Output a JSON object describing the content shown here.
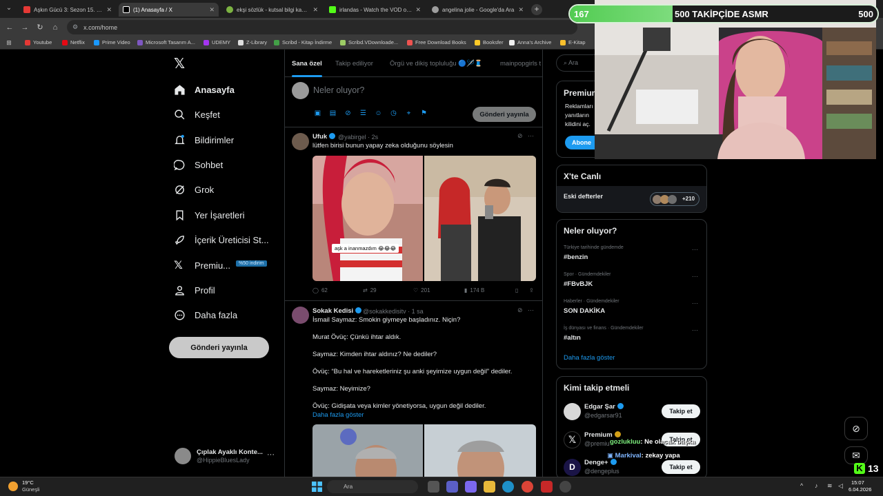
{
  "browser": {
    "tabs": [
      {
        "label": "Aşkın Gücü 3: Sezon 15. Bölüm",
        "color": "#e53935"
      },
      {
        "label": "(1) Anasayfa / X",
        "color": "#ffffff"
      },
      {
        "label": "ekşi sözlük - kutsal bilgi kaynağı",
        "color": "#7cb342"
      },
      {
        "label": "irlandas - Watch the VOD on Kick",
        "color": "#53fc18"
      },
      {
        "label": "angelina jolie - Google'da Ara",
        "color": "#9e9e9e"
      }
    ],
    "url": "x.com/home",
    "bookmarks": [
      "Youtube",
      "Netflix",
      "Prime Video",
      "Microsoft Tasarım A...",
      "UDEMY",
      "Z-Library",
      "Scribd - Kitap İndirme",
      "Scribd.VDownloade...",
      "Free Download Books",
      "Booksfer",
      "Anna's Archive",
      "E-Kitap"
    ]
  },
  "x": {
    "nav": [
      {
        "label": "Anasayfa",
        "icon": "home-icon"
      },
      {
        "label": "Keşfet",
        "icon": "search-icon"
      },
      {
        "label": "Bildirimler",
        "icon": "bell-icon"
      },
      {
        "label": "Sohbet",
        "icon": "chat-icon"
      },
      {
        "label": "Grok",
        "icon": "grok-icon"
      },
      {
        "label": "Yer İşaretleri",
        "icon": "bookmark-icon"
      },
      {
        "label": "İçerik Üreticisi St...",
        "icon": "rocket-icon"
      },
      {
        "label": "Premiu...",
        "icon": "x-logo-icon"
      },
      {
        "label": "Profil",
        "icon": "person-icon"
      },
      {
        "label": "Daha fazla",
        "icon": "more-circle-icon"
      }
    ],
    "premium_badge": "%50 indirim",
    "post_button": "Gönderi yayınla",
    "account": {
      "name": "Çıplak Ayaklı Konte...",
      "handle": "@HippieBluesLady"
    },
    "timeline_tabs": [
      "Sana özel",
      "Takip ediliyor",
      "Örgü ve dikiş topluluğu 🔵🪡🧵",
      "mainpopgirls t"
    ],
    "composer": {
      "placeholder": "Neler oluyor?",
      "button": "Gönderi yayınla"
    },
    "tweets": [
      {
        "name": "Ufuk",
        "handle": "@yabirgel",
        "time": "2s",
        "text": "lütfen birisi bunun yapay zeka olduğunu söylesin",
        "media_caption": "aşk a inanmazdım 😂😂😂",
        "replies": "62",
        "retweets": "29",
        "likes": "201",
        "views": "174 B"
      },
      {
        "name": "Sokak Kedisi",
        "handle": "@sokakkedisitv",
        "time": "1 sa",
        "lines": [
          "İsmail Saymaz: Smokin giymeye başladınız. Niçin?",
          "Murat Övüç: Çünkü ihtar aldık.",
          "Saymaz: Kimden ihtar aldınız? Ne dediler?",
          "Övüç: “Bu hal ve hareketleriniz şu anki şeyimize uygun değil” dediler.",
          "Saymaz: Neyimize?",
          "Övüç: Gidişata veya kimler yönetiyorsa, uygun değil dediler."
        ],
        "show_more": "Daha fazla göster"
      }
    ],
    "right": {
      "search_placeholder": "Ara",
      "premium": {
        "title": "Premium",
        "lines": [
          "Reklamları",
          "yanıtların",
          "kilidini aç."
        ],
        "button": "Abone"
      },
      "live": {
        "title": "X'te Canlı",
        "space": "Eski defterler",
        "count": "+210"
      },
      "trends_title": "Neler oluyor?",
      "trends": [
        {
          "category": "Türkiye tarihinde gündemde",
          "name": "#benzin"
        },
        {
          "category": "Spor · Gündemdekiler",
          "name": "#FBvBJK"
        },
        {
          "category": "Haberler · Gündemdekiler",
          "name": "SON DAKİKA"
        },
        {
          "category": "İş dünyası ve finans · Gündemdekiler",
          "name": "#altın"
        }
      ],
      "show_more": "Daha fazla göster",
      "who_to_follow": "Kimi takip etmeli",
      "suggestions": [
        {
          "name": "Edgar Şar",
          "handle": "@edgarsar91",
          "button": "Takip et"
        },
        {
          "name": "Premium",
          "handle": "@premiu",
          "button": "Takip et"
        },
        {
          "name": "Denge+",
          "handle": "@dengeplus",
          "button": "Takip et"
        }
      ]
    }
  },
  "stream": {
    "goal": {
      "current": "167",
      "title": "500 TAKİPÇİDE ASMR",
      "target": "500",
      "progress": 0.334
    },
    "chat": [
      {
        "user": "gozlukluu",
        "message": ": Ne olacak başka",
        "color": "#7ef07e"
      },
      {
        "user": "Markival",
        "message": ": zekay yapa",
        "color": "#7fb6ff"
      }
    ],
    "viewers": "13"
  },
  "taskbar": {
    "temp": "19°C",
    "weather": "Güneşli",
    "search": "Ara",
    "time": "15:07",
    "date": "6.04.2026"
  }
}
